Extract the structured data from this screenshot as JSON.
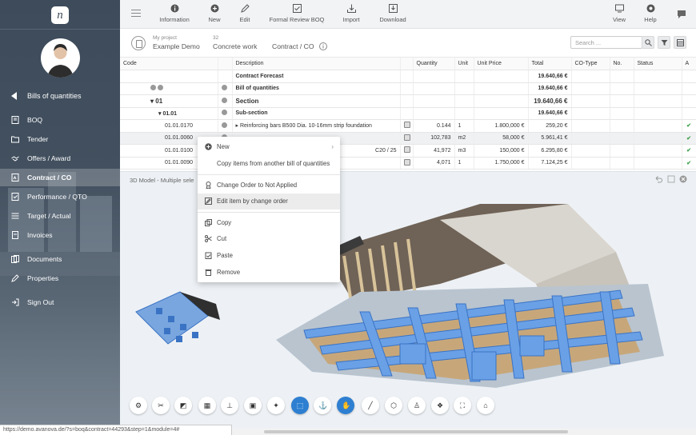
{
  "toolbar": {
    "buttons": [
      {
        "label": "Information",
        "icon": "info-icon"
      },
      {
        "label": "New",
        "icon": "plus-circle-icon"
      },
      {
        "label": "Edit",
        "icon": "pencil-icon"
      },
      {
        "label": "Formal Review BOQ",
        "icon": "checkbox-icon"
      },
      {
        "label": "Import",
        "icon": "import-icon"
      },
      {
        "label": "Download",
        "icon": "download-icon"
      }
    ],
    "right_buttons": [
      {
        "label": "View",
        "icon": "monitor-icon"
      },
      {
        "label": "Help",
        "icon": "lifebuoy-icon"
      }
    ]
  },
  "sidebar": {
    "logo": "n",
    "back_label": "Bills of quantities",
    "items": [
      {
        "label": "BOQ",
        "icon": "document-icon"
      },
      {
        "label": "Tender",
        "icon": "folder-icon"
      },
      {
        "label": "Offers / Award",
        "icon": "handshake-icon"
      },
      {
        "label": "Contract / CO",
        "icon": "contract-icon",
        "active": true
      },
      {
        "label": "Performance / QTO",
        "icon": "check-document-icon"
      },
      {
        "label": "Target / Actual",
        "icon": "bars-icon"
      },
      {
        "label": "Invoices",
        "icon": "invoice-icon"
      },
      {
        "label": "Documents",
        "icon": "documents-icon"
      },
      {
        "label": "Properties",
        "icon": "pencil-icon"
      },
      {
        "label": "Sign Out",
        "icon": "sign-out-icon"
      }
    ]
  },
  "context_bar": {
    "project_small": "My project",
    "project": "Example Demo",
    "number_small": "32",
    "section": "Concrete work",
    "module": "Contract / CO",
    "search_placeholder": "Search ..."
  },
  "table": {
    "headers": [
      "Code",
      "",
      "Description",
      "",
      "Quantity",
      "Unit",
      "Unit Price",
      "Total",
      "CO-Type",
      "No.",
      "Status",
      "A"
    ],
    "rows": [
      {
        "code": "",
        "desc": "Contract Forecast",
        "qty": "",
        "unit": "",
        "price": "",
        "total": "19.640,66 €",
        "bold": true,
        "check": false
      },
      {
        "code": "",
        "desc": "Bill of quantities",
        "qty": "",
        "unit": "",
        "price": "",
        "total": "19.640,66 €",
        "bold": true,
        "check": false
      },
      {
        "code": "01",
        "desc": "Section",
        "qty": "",
        "unit": "",
        "price": "",
        "total": "19.640,66 €",
        "bold": true,
        "check": false
      },
      {
        "code": "01.01",
        "desc": "Sub-section",
        "qty": "",
        "unit": "",
        "price": "",
        "total": "19.640,66 €",
        "bold": true,
        "check": false
      },
      {
        "code": "01.01.0170",
        "desc": "Reinforcing bars B500 Dia. 10-16mm strip foundation",
        "qty": "0.144",
        "unit": "1",
        "price": "1.800,000 €",
        "total": "259,20 €",
        "bold": false,
        "check": true
      },
      {
        "code": "01.01.0060",
        "desc": "",
        "qty": "102,783",
        "unit": "m2",
        "price": "58,000 €",
        "total": "5.961,41 €",
        "bold": false,
        "check": true
      },
      {
        "code": "01.01.0100",
        "desc": "C20 / 25",
        "qty": "41,972",
        "unit": "m3",
        "price": "150,000 €",
        "total": "6.295,80 €",
        "bold": false,
        "check": true
      },
      {
        "code": "01.01.0090",
        "desc": "",
        "qty": "4,071",
        "unit": "1",
        "price": "1.750,000 €",
        "total": "7.124,25 €",
        "bold": false,
        "check": true
      }
    ]
  },
  "panel": {
    "title": "3D Model - Multiple sele"
  },
  "context_menu": {
    "items": [
      {
        "label": "New",
        "icon": "plus-circle-icon",
        "submenu": true
      },
      {
        "label": "Copy items from another bill of quantities",
        "icon": ""
      },
      {
        "label": "Change Order to Not Applied",
        "icon": "medal-icon"
      },
      {
        "label": "Edit item by change order",
        "icon": "edit-icon",
        "highlighted": true
      },
      {
        "label": "Copy",
        "icon": "copy-icon"
      },
      {
        "label": "Cut",
        "icon": "scissors-icon"
      },
      {
        "label": "Paste",
        "icon": "paste-icon"
      },
      {
        "label": "Remove",
        "icon": "trash-icon"
      }
    ]
  },
  "viewer_tools": [
    "gear-icon",
    "tools-icon",
    "section-icon",
    "grid-icon",
    "measure-icon",
    "save-icon",
    "pivot-icon",
    "select-box-icon",
    "anchor-icon",
    "hand-icon",
    "ruler-icon",
    "box-icon",
    "person-icon",
    "cubes-icon",
    "fit-icon",
    "home-icon"
  ],
  "status_url": "https://demo.avanova.de/?s=boq&contract=44293&step=1&module=4#",
  "colors": {
    "sidebar": "#3d4b5b",
    "accent": "#2e7fd1",
    "check": "#3fa14a"
  }
}
